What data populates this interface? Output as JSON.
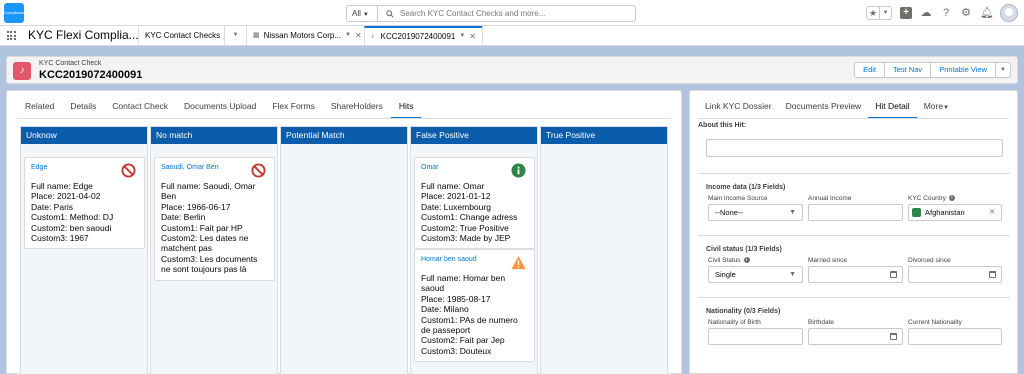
{
  "header": {
    "logo_text": "Compliance",
    "search_scope": "All",
    "search_placeholder": "Search KYC Contact Checks and more..."
  },
  "tabbar": {
    "app_name": "KYC Flexi Complia...",
    "tabs": [
      {
        "label": "KYC Contact Checks"
      },
      {
        "label": "Nissan Motors Corp..."
      },
      {
        "label": "KCC2019072400091"
      }
    ]
  },
  "record": {
    "object_label": "KYC Contact Check",
    "title": "KCC2019072400091",
    "buttons": [
      "Edit",
      "Test Nav",
      "Printable View"
    ]
  },
  "main": {
    "tabs": [
      "Related",
      "Details",
      "Contact Check",
      "Documents Upload",
      "Flex Forms",
      "ShareHolders",
      "Hits"
    ],
    "active_tab": "Hits",
    "columns": [
      {
        "title": "Unknow",
        "cards": [
          {
            "name": "Edge",
            "status": "blocked",
            "lines": [
              "Full name: Edge",
              "Place: 2021-04-02",
              "Date: Paris",
              "Custom1: Method: DJ",
              "Custom2: ben saoudi",
              "Custom3: 1967"
            ]
          }
        ]
      },
      {
        "title": "No match",
        "cards": [
          {
            "name": "Saoudi, Omar Ben",
            "status": "blocked",
            "lines": [
              "Full name: Saoudi, Omar",
              "Ben",
              "Place: 1966-06-17",
              "Date: Berlin",
              "Custom1: Fait par HP",
              "Custom2: Les dates ne",
              "matchent pas",
              "Custom3: Les documents",
              "ne sont toujours pas là"
            ]
          }
        ]
      },
      {
        "title": "Potential Match",
        "cards": []
      },
      {
        "title": "False Positive",
        "cards": [
          {
            "name": "Omar",
            "status": "info",
            "lines": [
              "Full name: Omar",
              "Place: 2021-01-12",
              "Date: Luxembourg",
              "Custom1: Change adress",
              "Custom2: True Positive",
              "Custom3: Made by JEP"
            ]
          },
          {
            "name": "Homar ben saoud",
            "status": "warning",
            "lines": [
              "Full name: Homar ben",
              "saoud",
              "Place: 1985-08-17",
              "Date: Milano",
              "Custom1: PAs de numero",
              "de passeport",
              "Custom2: Fait par Jep",
              "Custom3: Douteux"
            ]
          }
        ]
      },
      {
        "title": "True Positive",
        "cards": []
      }
    ]
  },
  "side": {
    "tabs": [
      "Link KYC Dossier",
      "Documents Preview",
      "Hit Detail",
      "More"
    ],
    "active_tab": "Hit Detail",
    "about_label": "About this Hit:",
    "income": {
      "title": "Income data (1/3 Fields)",
      "main_source_label": "Main Income Source",
      "main_source_value": "--None--",
      "annual_label": "Annual Income",
      "country_label": "KYC Country",
      "country_value": "Afghanistan"
    },
    "civil": {
      "title": "Civil status (1/3 Fields)",
      "status_label": "Civil Status",
      "status_value": "Single",
      "married_label": "Married since",
      "divorced_label": "Divorced since"
    },
    "nationality": {
      "title": "Nationality (0/3 Fields)",
      "birth_nat_label": "Nationality of Birth",
      "birthdate_label": "Birthdate",
      "current_label": "Current Nationality"
    }
  },
  "colors": {
    "column_header": "#0b5cab",
    "link": "#0176d3",
    "blocked_icon": "#c23934",
    "info_icon": "#2e844a",
    "warning_icon": "#fe9339"
  }
}
